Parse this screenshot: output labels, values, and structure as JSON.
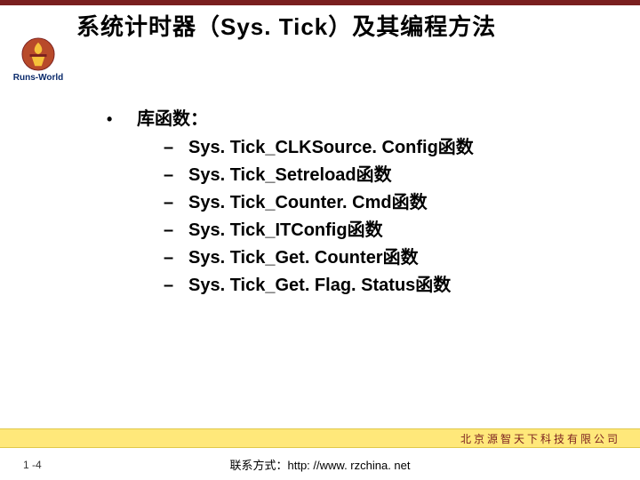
{
  "logo": {
    "text": "Runs-World"
  },
  "title": "系统计时器（Sys. Tick）及其编程方法",
  "content": {
    "bullet_label": "库函数：",
    "items": [
      "Sys. Tick_CLKSource. Config函数",
      "Sys. Tick_Setreload函数",
      "Sys. Tick_Counter. Cmd函数",
      "Sys. Tick_ITConfig函数",
      "Sys. Tick_Get. Counter函数",
      "Sys. Tick_Get. Flag. Status函数"
    ]
  },
  "company": "北京源智天下科技有限公司",
  "page_number": "1 -4",
  "contact": "联系方式：http: //www. rzchina. net"
}
